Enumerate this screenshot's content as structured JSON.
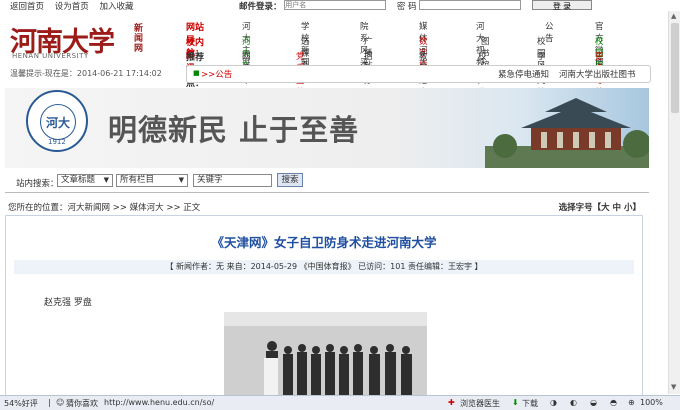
{
  "top_links": [
    "返回首页",
    "设为首页",
    "加入收藏"
  ],
  "login": {
    "label": "邮件登录：",
    "user_placeholder": "用户名",
    "password_label": "密  码",
    "submit": "登  录"
  },
  "logo": {
    "cn": "河南大学",
    "news": "新闻网",
    "en": "HENAN UNIVERSITY"
  },
  "nav": {
    "row1": {
      "title": "网站导航：",
      "items": [
        "河大主页",
        "学校新闻",
        "院系风采",
        "媒体河大",
        "河大视频",
        "公告",
        "官方微博"
      ]
    },
    "row2": {
      "title": "校内资讯：",
      "items": [
        "河大在线",
        "选课系统",
        "广播站",
        "数字校园",
        "图书馆",
        "校园风光",
        "校园服务"
      ]
    },
    "row3": {
      "title": "推荐站点：",
      "items": [
        "网络中心",
        "党委宣传部",
        "招生办",
        "教工之家",
        "校办产业",
        "学术网站",
        "更多导航"
      ]
    }
  },
  "status_line": "温馨提示-现在是：2014-06-21 17:14:02",
  "notice": {
    "label": ">>公告",
    "items": [
      "紧急停电通知",
      "河南大学出版社图书"
    ]
  },
  "banner": {
    "slogan": "明德新民  止于至善",
    "seal_text": "河大",
    "seal_year": "1912"
  },
  "search": {
    "label": "站内搜索：",
    "field1": "文章标题",
    "field2": "所有栏目",
    "keyword": "关键字",
    "button": "搜索"
  },
  "breadcrumb": "您所在的位置：河大新闻网 >> 媒体河大 >> 正文",
  "font_size": "选择字号【大  中  小】",
  "article": {
    "title": "《天津网》女子自卫防身术走进河南大学",
    "meta": "【 新闻作者：无   来自：2014-05-29 《中国体育报》   已访问：101   责任编辑：王宏宇 】",
    "authors": "赵克强  罗盘"
  },
  "statusbar": {
    "left": "54%好评",
    "like": "猜你喜欢",
    "url": "http://www.henu.edu.cn/so/",
    "doctor": "浏览器医生",
    "download": "下载",
    "zoom": "100%"
  }
}
